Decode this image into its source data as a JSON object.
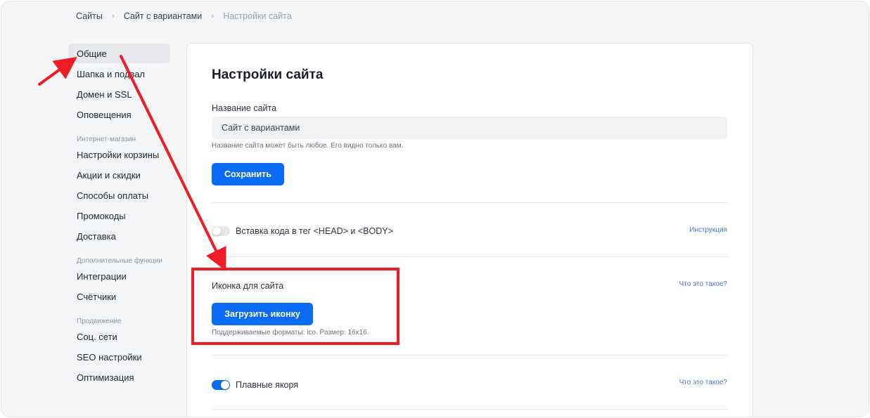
{
  "breadcrumb": [
    "Сайты",
    "Сайт с вариантами",
    "Настройки сайта"
  ],
  "sidebar": {
    "items_top": [
      "Общие",
      "Шапка и подвал",
      "Домен и SSL",
      "Оповещения"
    ],
    "group_shop": "Интернет-магазин",
    "items_shop": [
      "Настройки корзины",
      "Акции и скидки",
      "Способы оплаты",
      "Промокоды",
      "Доставка"
    ],
    "group_extra": "Дополнительные функции",
    "items_extra": [
      "Интеграции",
      "Счётчики"
    ],
    "group_promo": "Продвижение",
    "items_promo": [
      "Соц. сети",
      "SEO настройки",
      "Оптимизация"
    ]
  },
  "main": {
    "title": "Настройки сайта",
    "name_label": "Название сайта",
    "name_value": "Сайт с вариантами",
    "name_hint": "Название сайта может быть любое. Его видно только вам.",
    "save_label": "Сохранить",
    "code_toggle_label": "Вставка кода в тег <HEAD> и <BODY>",
    "code_link": "Инструкция",
    "icon_label": "Иконка для сайта",
    "icon_link": "Что это такое?",
    "upload_label": "Загрузить иконку",
    "upload_hint": "Поддерживаемые форматы: ico. Размер: 16x16.",
    "anchors_label": "Плавные якоря",
    "anchors_link": "Что это такое?"
  },
  "colors": {
    "accent": "#0a6cf5",
    "annotation": "#ee1c24"
  }
}
